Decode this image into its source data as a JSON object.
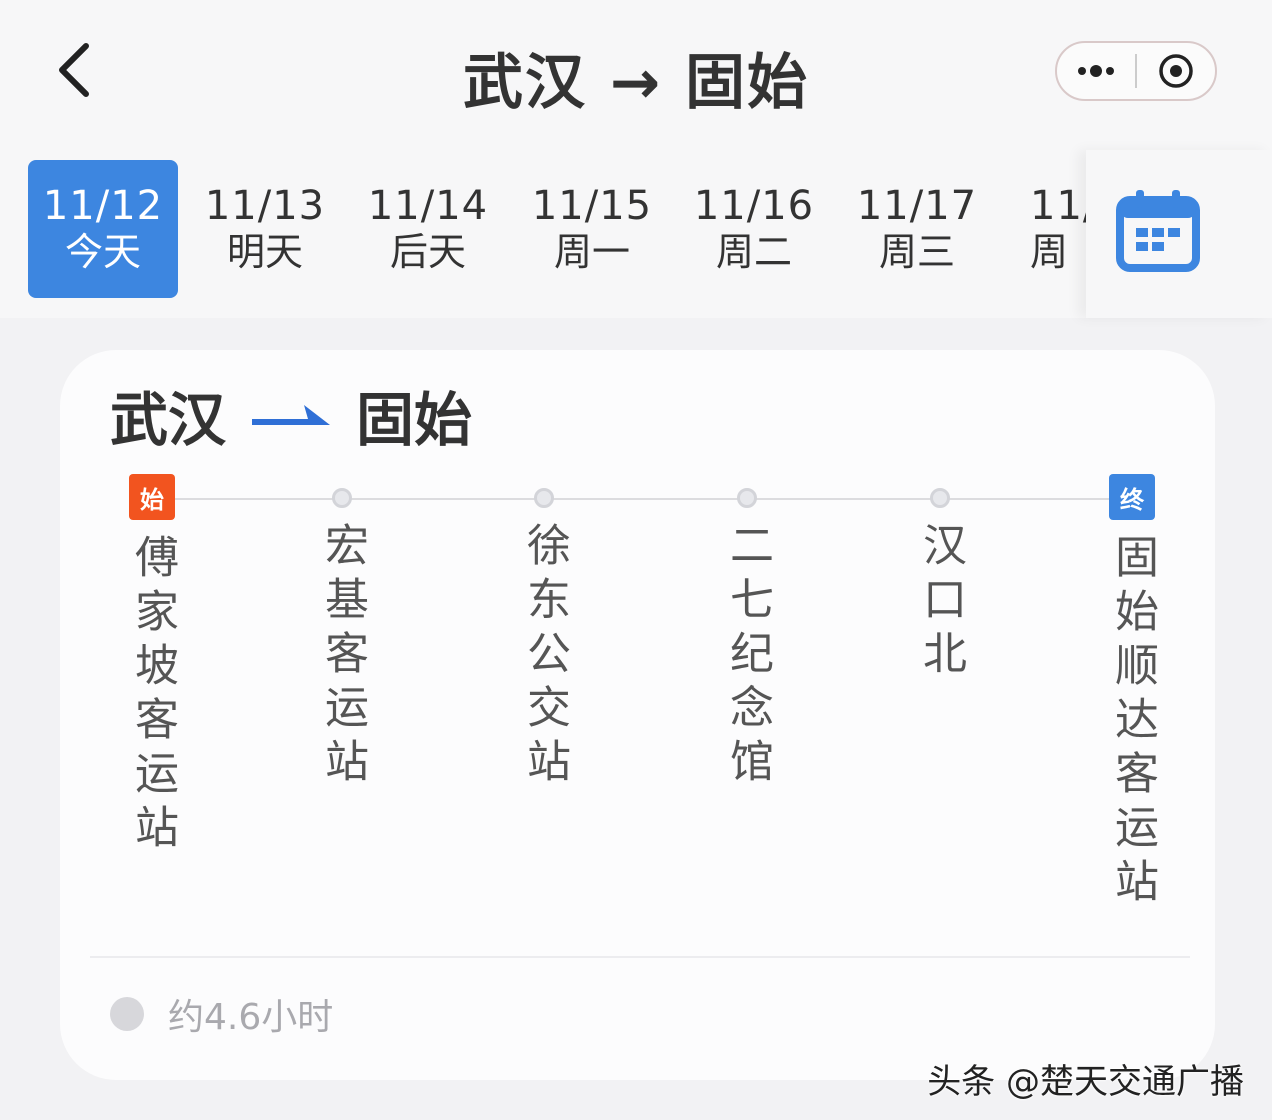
{
  "nav": {
    "title": "武汉 → 固始"
  },
  "dates": [
    {
      "date": "11/12",
      "weekday": "今天",
      "active": true
    },
    {
      "date": "11/13",
      "weekday": "明天",
      "active": false
    },
    {
      "date": "11/14",
      "weekday": "后天",
      "active": false
    },
    {
      "date": "11/15",
      "weekday": "周一",
      "active": false
    },
    {
      "date": "11/16",
      "weekday": "周二",
      "active": false
    },
    {
      "date": "11/17",
      "weekday": "周三",
      "active": false
    },
    {
      "date": "11/",
      "weekday": "周",
      "active": false
    }
  ],
  "colors": {
    "accent": "#3d86e0",
    "start_badge": "#f2541f",
    "end_badge": "#3d86e0"
  },
  "route": {
    "from": "武汉",
    "to": "固始",
    "stops": [
      {
        "name": "傅家坡客运站",
        "type": "start",
        "badge": "始"
      },
      {
        "name": "宏基客运站",
        "type": "via"
      },
      {
        "name": "徐东公交站",
        "type": "via"
      },
      {
        "name": "二七纪念馆",
        "type": "via"
      },
      {
        "name": "汉口北",
        "type": "via"
      },
      {
        "name": "固始顺达客运站",
        "type": "end",
        "badge": "终"
      }
    ],
    "duration": "约4.6小时"
  },
  "icons": {
    "back": "chevron-left-icon",
    "more": "more-dots-icon",
    "close": "target-circle-icon",
    "calendar": "calendar-icon",
    "clock": "clock-icon"
  },
  "watermark": "头条 @楚天交通广播"
}
